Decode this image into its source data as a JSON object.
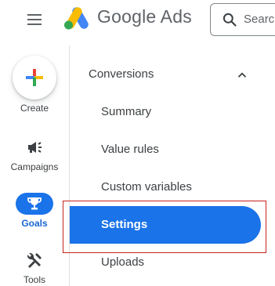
{
  "header": {
    "brand": "Google Ads",
    "search_placeholder": "Search"
  },
  "rail": {
    "create_label": "Create",
    "campaigns_label": "Campaigns",
    "goals_label": "Goals",
    "tools_label": "Tools"
  },
  "subnav": {
    "section_title": "Conversions",
    "items": [
      "Summary",
      "Value rules",
      "Custom variables",
      "Settings",
      "Uploads"
    ],
    "active_item": "Settings"
  },
  "colors": {
    "accent": "#1a73e8",
    "highlight_border": "#c5221f",
    "google_blue": "#4285f4",
    "google_red": "#ea4335",
    "google_yellow": "#fbbc04",
    "google_green": "#34a853"
  },
  "icons": [
    "menu-icon",
    "google-ads-logo",
    "search-icon",
    "plus-icon",
    "megaphone-icon",
    "trophy-icon",
    "tools-icon",
    "chevron-up-icon"
  ]
}
